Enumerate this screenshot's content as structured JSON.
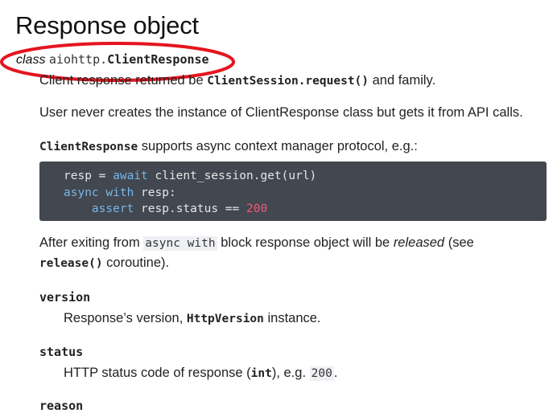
{
  "title": "Response object",
  "class_sig": {
    "keyword": "class",
    "module": "aiohttp.",
    "name": "ClientResponse"
  },
  "para1": {
    "pre": "Client response returned be ",
    "code": "ClientSession.request()",
    "post": " and family."
  },
  "para2": "User never creates the instance of ClientResponse class but gets it from API calls.",
  "para3": {
    "code": "ClientResponse",
    "post": " supports async context manager protocol, e.g.:"
  },
  "code_block": {
    "line1_a": "resp = ",
    "line1_kw": "await",
    "line1_b": " client_session.get(url)",
    "line2_kw1": "async",
    "line2_kw2": "with",
    "line2_b": " resp:",
    "line3_kw": "assert",
    "line3_b": " resp.status == ",
    "line3_num": "200"
  },
  "para4": {
    "pre": "After exiting from ",
    "code": "async with",
    "mid": " block response object will be ",
    "em": "released",
    "post": " (see",
    "line2_code": "release()",
    "line2_post": " coroutine)."
  },
  "attributes": [
    {
      "name": "version",
      "desc_pre": "Response’s version, ",
      "desc_code": "HttpVersion",
      "desc_post": " instance."
    },
    {
      "name": "status",
      "desc_pre": "HTTP status code of response (",
      "desc_code": "int",
      "desc_mid": "), e.g. ",
      "desc_code2": "200",
      "desc_post": "."
    }
  ],
  "next_attr_partial": "reason",
  "colors": {
    "annotation_ellipse": "#e4151f",
    "code_bg": "#43474f",
    "code_keyword": "#75b7ea",
    "code_number": "#f05a7c"
  }
}
